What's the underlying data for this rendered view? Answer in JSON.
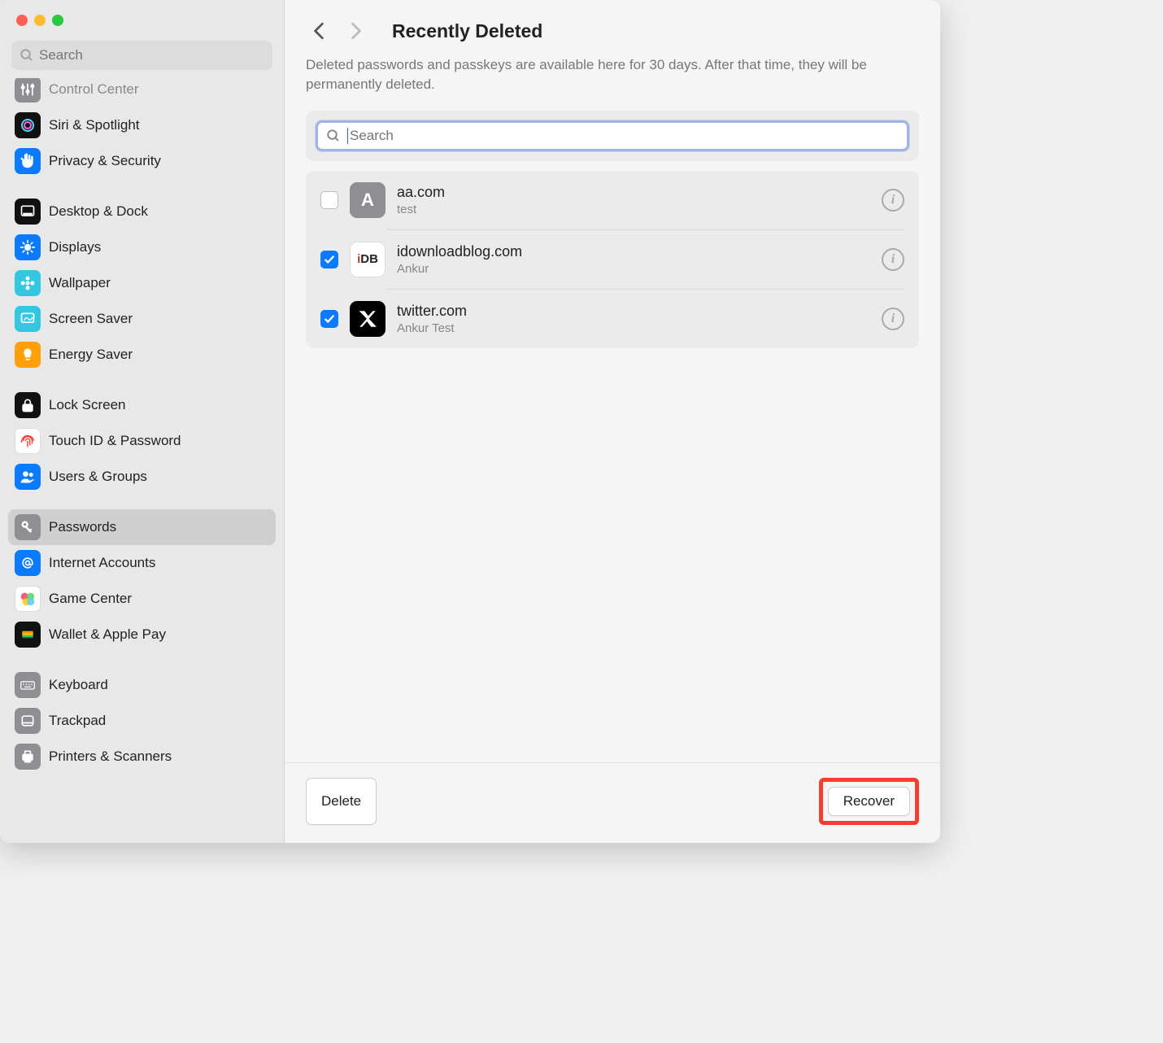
{
  "sidebar": {
    "searchPlaceholder": "Search",
    "groups": [
      {
        "items": [
          {
            "id": "control-center",
            "label": "Control Center",
            "icon": "sliders",
            "bg": "#8e8e93",
            "truncated": true
          },
          {
            "id": "siri-spotlight",
            "label": "Siri & Spotlight",
            "icon": "siri",
            "bg": "#111"
          },
          {
            "id": "privacy-security",
            "label": "Privacy & Security",
            "icon": "hand",
            "bg": "#0a7aff"
          }
        ]
      },
      {
        "items": [
          {
            "id": "desktop-dock",
            "label": "Desktop & Dock",
            "icon": "dock",
            "bg": "#111"
          },
          {
            "id": "displays",
            "label": "Displays",
            "icon": "sun",
            "bg": "#0a7aff"
          },
          {
            "id": "wallpaper",
            "label": "Wallpaper",
            "icon": "flower",
            "bg": "#34c8e0"
          },
          {
            "id": "screen-saver",
            "label": "Screen Saver",
            "icon": "screensaver",
            "bg": "#34c8e0"
          },
          {
            "id": "energy-saver",
            "label": "Energy Saver",
            "icon": "bulb",
            "bg": "#ff9f0a"
          }
        ]
      },
      {
        "items": [
          {
            "id": "lock-screen",
            "label": "Lock Screen",
            "icon": "lock",
            "bg": "#111"
          },
          {
            "id": "touch-id",
            "label": "Touch ID & Password",
            "icon": "fingerprint-red",
            "bg": "#fff"
          },
          {
            "id": "users-groups",
            "label": "Users & Groups",
            "icon": "users",
            "bg": "#0a7aff"
          }
        ]
      },
      {
        "items": [
          {
            "id": "passwords",
            "label": "Passwords",
            "icon": "key",
            "bg": "#8e8e93",
            "selected": true
          },
          {
            "id": "internet-accounts",
            "label": "Internet Accounts",
            "icon": "at",
            "bg": "#0a7aff"
          },
          {
            "id": "game-center",
            "label": "Game Center",
            "icon": "gamecenter",
            "bg": "#fff"
          },
          {
            "id": "wallet-applepay",
            "label": "Wallet & Apple Pay",
            "icon": "wallet",
            "bg": "#111"
          }
        ]
      },
      {
        "items": [
          {
            "id": "keyboard",
            "label": "Keyboard",
            "icon": "keyboard",
            "bg": "#8e8e93"
          },
          {
            "id": "trackpad",
            "label": "Trackpad",
            "icon": "trackpad",
            "bg": "#8e8e93"
          },
          {
            "id": "printers-scanners",
            "label": "Printers & Scanners",
            "icon": "printer",
            "bg": "#8e8e93"
          }
        ]
      }
    ]
  },
  "main": {
    "title": "Recently Deleted",
    "description": "Deleted passwords and passkeys are available here for 30 days. After that time, they will be permanently deleted.",
    "searchPlaceholder": "Search",
    "items": [
      {
        "site": "aa.com",
        "user": "test",
        "checked": false,
        "iconText": "A",
        "iconBg": "#8e8e93"
      },
      {
        "site": "idownloadblog.com",
        "user": "Ankur",
        "checked": true,
        "iconText": "iDB",
        "iconBg": "#fff",
        "iconFg": "#c63a1e",
        "iconStyle": "idb"
      },
      {
        "site": "twitter.com",
        "user": "Ankur Test",
        "checked": true,
        "iconText": "X",
        "iconBg": "#000",
        "iconStyle": "x"
      }
    ]
  },
  "footer": {
    "deleteLabel": "Delete",
    "recoverLabel": "Recover"
  }
}
